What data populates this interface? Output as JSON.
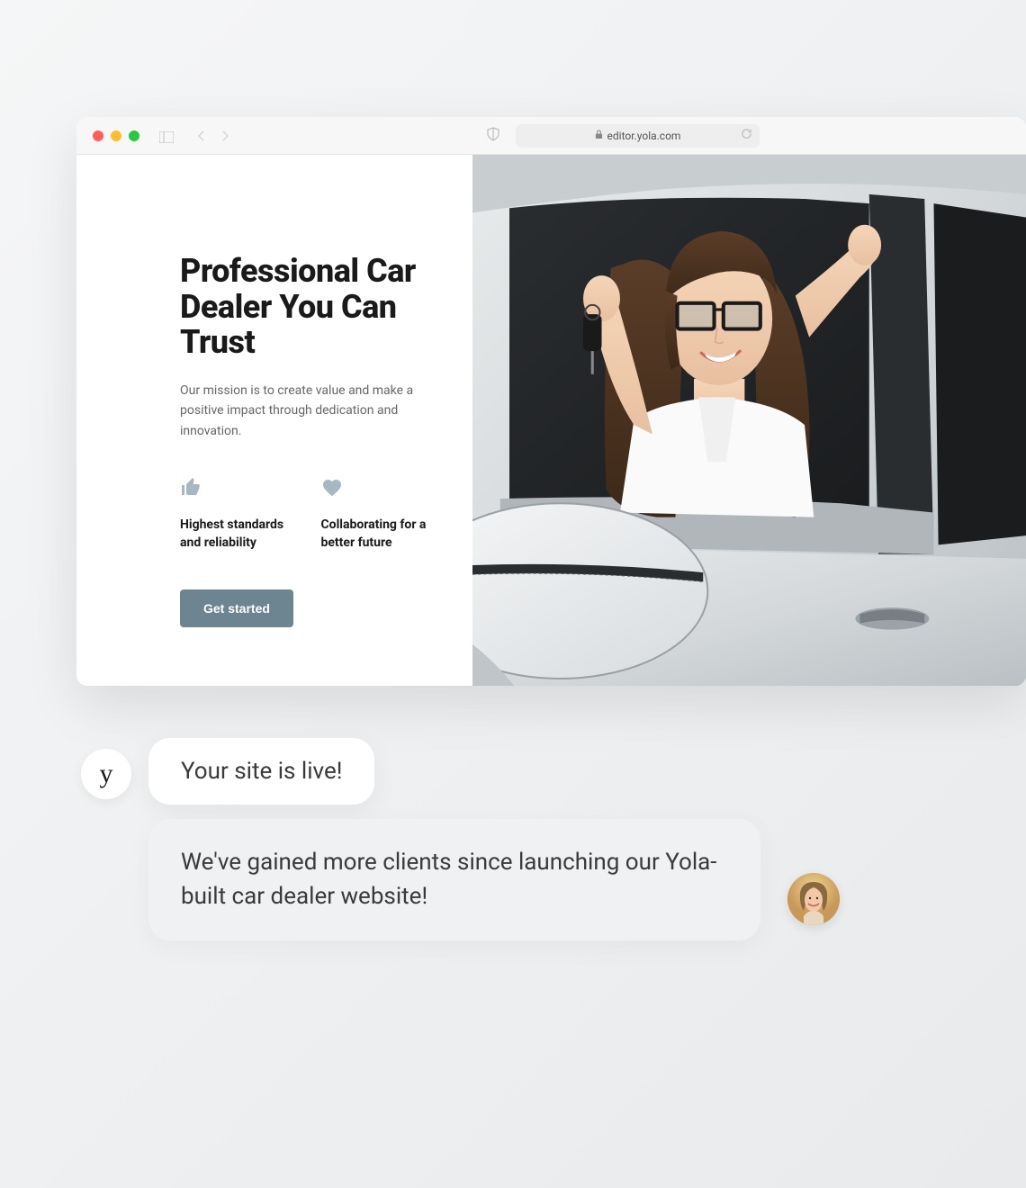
{
  "browser": {
    "url": "editor.yola.com"
  },
  "hero": {
    "title": "Professional Car Dealer You Can Trust",
    "description": "Our mission is to create value and make a positive impact through dedication and innovation.",
    "cta_label": "Get started"
  },
  "features": [
    {
      "icon": "thumbs-up",
      "text": "Highest standards and reliability"
    },
    {
      "icon": "heart",
      "text": "Collaborating for a better future"
    }
  ],
  "chat": {
    "bubble1": "Your site is live!",
    "bubble2": "We've gained more clients since launching our Yola-built car dealer website!",
    "yola_logo": "y"
  }
}
